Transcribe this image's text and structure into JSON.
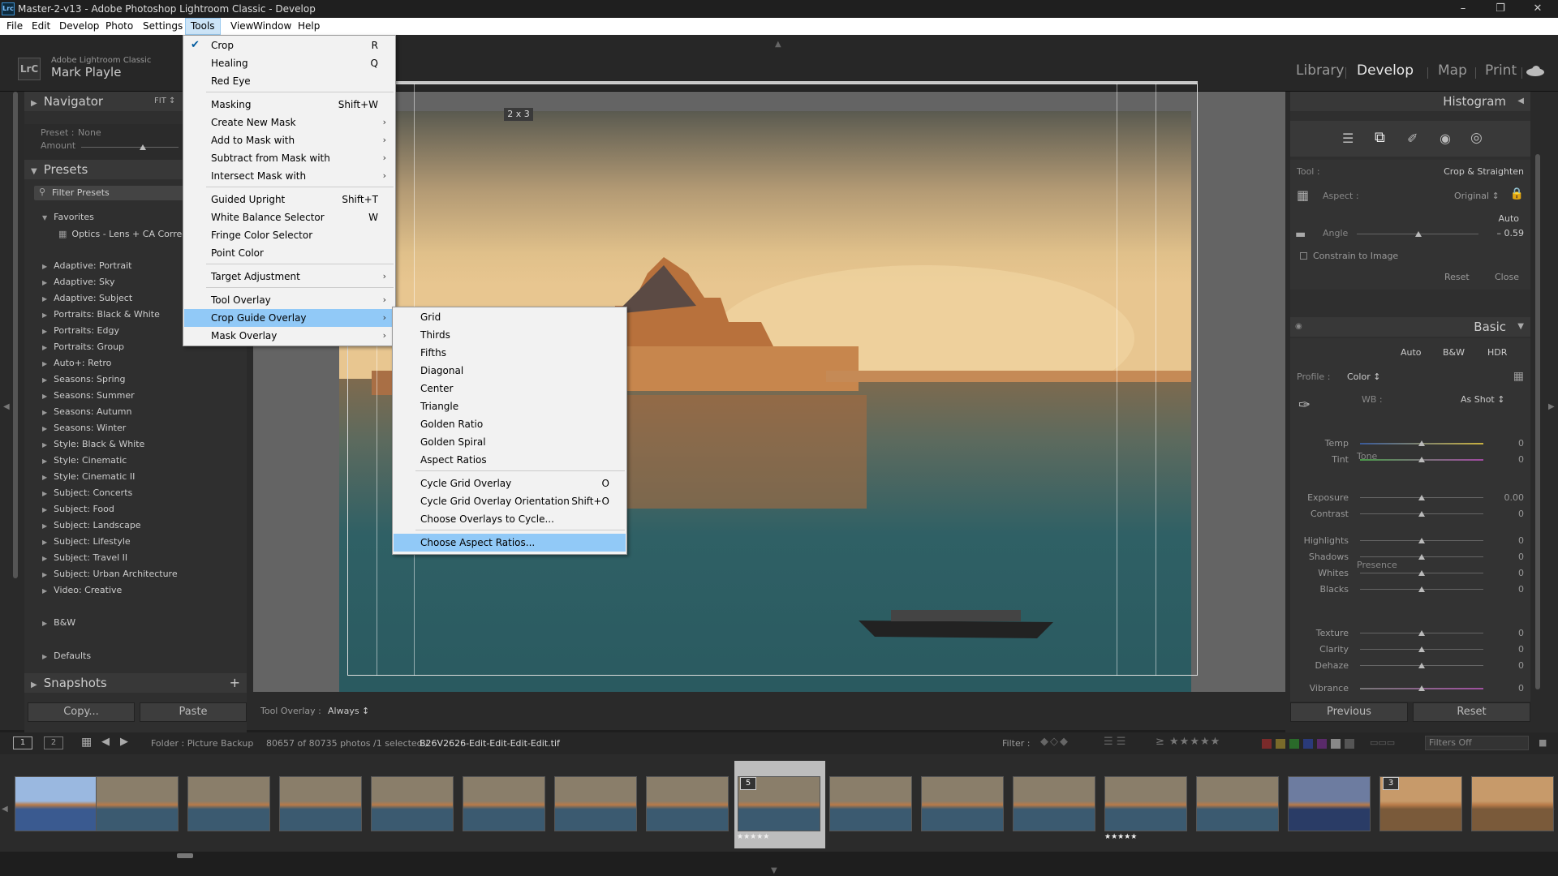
{
  "window": {
    "title": "Master-2-v13 - Adobe Photoshop Lightroom Classic - Develop",
    "app_badge": "Lrc"
  },
  "menubar": [
    "File",
    "Edit",
    "Develop",
    "Photo",
    "Settings",
    "Tools",
    "View",
    "Window",
    "Help"
  ],
  "identity": {
    "app": "Adobe Lightroom Classic",
    "user": "Mark Playle",
    "badge": "LrC"
  },
  "modules": [
    "Library",
    "Develop",
    "Map",
    "Print"
  ],
  "left": {
    "navigator": "Navigator",
    "fit": "FIT ↕",
    "preset_label": "Preset :",
    "preset_value": "None",
    "amount_label": "Amount",
    "presets": "Presets",
    "filter_presets": "Filter Presets",
    "favorites": "Favorites",
    "favorite_item": "Optics - Lens + CA Correcti",
    "groups": [
      "Adaptive: Portrait",
      "Adaptive: Sky",
      "Adaptive: Subject",
      "Portraits: Black & White",
      "Portraits: Edgy",
      "Portraits: Group",
      "Auto+: Retro",
      "Seasons: Spring",
      "Seasons: Summer",
      "Seasons: Autumn",
      "Seasons: Winter",
      "Style: Black & White",
      "Style: Cinematic",
      "Style: Cinematic II",
      "Subject: Concerts",
      "Subject: Food",
      "Subject: Landscape",
      "Subject: Lifestyle",
      "Subject: Travel II",
      "Subject: Urban Architecture",
      "Video: Creative"
    ],
    "bw": "B&W",
    "defaults": "Defaults",
    "snapshots": "Snapshots",
    "copy": "Copy...",
    "paste": "Paste"
  },
  "tools_menu": [
    {
      "label": "Crop",
      "shortcut": "R",
      "checked": true
    },
    {
      "label": "Healing",
      "shortcut": "Q"
    },
    {
      "label": "Red Eye",
      "shortcut": ""
    },
    {
      "label": "Masking",
      "shortcut": "Shift+W"
    },
    {
      "label": "Create New Mask",
      "submenu": true
    },
    {
      "label": "Add to Mask with",
      "submenu": true
    },
    {
      "label": "Subtract from Mask with",
      "submenu": true
    },
    {
      "label": "Intersect Mask with",
      "submenu": true
    },
    {
      "label": "Guided Upright",
      "shortcut": "Shift+T"
    },
    {
      "label": "White Balance Selector",
      "shortcut": "W"
    },
    {
      "label": "Fringe Color Selector",
      "shortcut": ""
    },
    {
      "label": "Point Color",
      "shortcut": ""
    },
    {
      "label": "Target Adjustment",
      "submenu": true
    },
    {
      "label": "Tool Overlay",
      "submenu": true
    },
    {
      "label": "Crop Guide Overlay",
      "submenu": true,
      "highlighted": true
    },
    {
      "label": "Mask Overlay",
      "submenu": true
    }
  ],
  "crop_menu": [
    {
      "label": "Grid"
    },
    {
      "label": "Thirds"
    },
    {
      "label": "Fifths"
    },
    {
      "label": "Diagonal"
    },
    {
      "label": "Center"
    },
    {
      "label": "Triangle"
    },
    {
      "label": "Golden Ratio"
    },
    {
      "label": "Golden Spiral"
    },
    {
      "label": "Aspect Ratios"
    },
    {
      "label": "Cycle Grid Overlay",
      "shortcut": "O"
    },
    {
      "label": "Cycle Grid Overlay Orientation",
      "shortcut": "Shift+O"
    },
    {
      "label": "Choose Overlays to Cycle..."
    },
    {
      "label": "Choose Aspect Ratios...",
      "highlighted": true
    }
  ],
  "crop_ratio": "2 x 3",
  "toolbar": {
    "tool_overlay_label": "Tool Overlay :",
    "tool_overlay_value": "Always ↕"
  },
  "right": {
    "histogram": "Histogram",
    "tool_label": "Tool :",
    "tool_value": "Crop & Straighten",
    "aspect_label": "Aspect :",
    "aspect_value": "Original ↕",
    "auto": "Auto",
    "angle_label": "Angle",
    "angle_value": "– 0.59",
    "constrain": "Constrain to Image",
    "reset": "Reset",
    "close": "Close",
    "basic": "Basic",
    "auto_btn": "Auto",
    "bw_btn": "B&W",
    "hdr_btn": "HDR",
    "profile_label": "Profile :",
    "profile_value": "Color ↕",
    "wb_label": "WB :",
    "wb_value": "As Shot ↕",
    "tone": "Tone",
    "presence": "Presence",
    "sliders": [
      {
        "label": "Temp",
        "value": "0"
      },
      {
        "label": "Tint",
        "value": "0"
      },
      {
        "label": "Exposure",
        "value": "0.00"
      },
      {
        "label": "Contrast",
        "value": "0"
      },
      {
        "label": "Highlights",
        "value": "0"
      },
      {
        "label": "Shadows",
        "value": "0"
      },
      {
        "label": "Whites",
        "value": "0"
      },
      {
        "label": "Blacks",
        "value": "0"
      },
      {
        "label": "Texture",
        "value": "0"
      },
      {
        "label": "Clarity",
        "value": "0"
      },
      {
        "label": "Dehaze",
        "value": "0"
      },
      {
        "label": "Vibrance",
        "value": "0"
      }
    ],
    "previous": "Previous",
    "reset_btn": "Reset"
  },
  "filmstrip_bar": {
    "view1": "1",
    "view2": "2",
    "folder": "Folder : Picture Backup",
    "count": "80657 of 80735 photos /1 selected /",
    "filename": "B26V2626-Edit-Edit-Edit-Edit.tif",
    "filter_label": "Filter :",
    "filters_off": "Filters Off",
    "stack1": "5",
    "stack2": "3",
    "stars": "★★★★★"
  }
}
